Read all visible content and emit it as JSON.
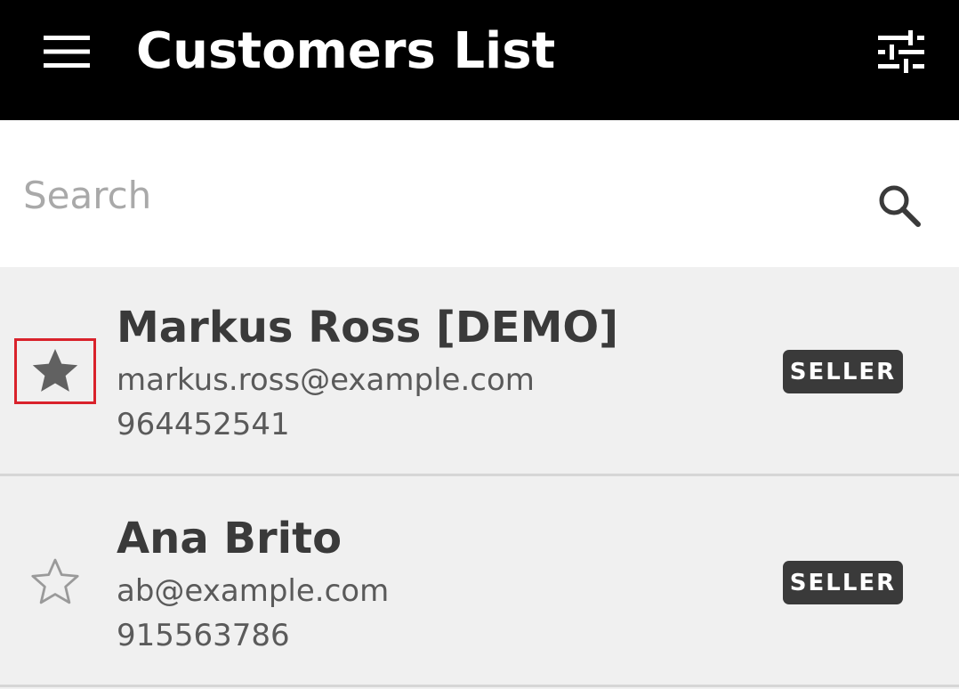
{
  "header": {
    "title": "Customers List",
    "menu_icon": "hamburger-menu-icon",
    "filter_icon": "tune-sliders-icon"
  },
  "search": {
    "placeholder": "Search",
    "value": "",
    "icon": "search-icon"
  },
  "customers": [
    {
      "name": "Markus Ross [DEMO]",
      "email": "markus.ross@example.com",
      "phone": "964452541",
      "badge": "SELLER",
      "favorite": true,
      "star_icon": "star-filled-icon"
    },
    {
      "name": "Ana Brito",
      "email": "ab@example.com",
      "phone": "915563786",
      "badge": "SELLER",
      "favorite": false,
      "star_icon": "star-outline-icon"
    }
  ],
  "colors": {
    "appbar": "#000000",
    "list_background": "#f0f0f0",
    "badge": "#3a3a3a",
    "selection_highlight": "#d9222b"
  }
}
